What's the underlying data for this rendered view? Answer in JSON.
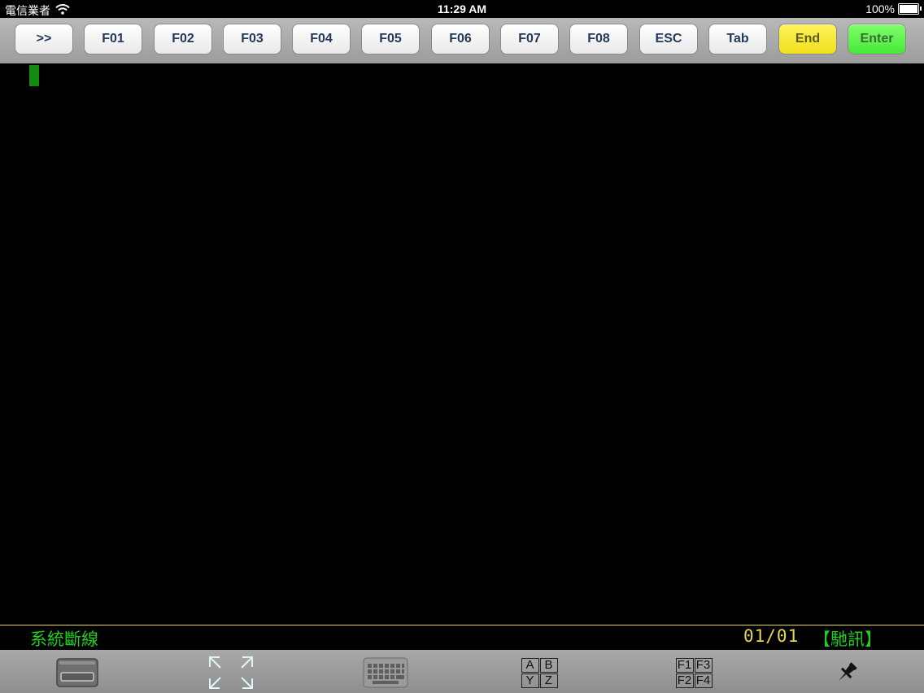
{
  "status_bar": {
    "carrier": "電信業者",
    "time": "11:29 AM",
    "battery_text": "100%",
    "battery_level": 1.0
  },
  "function_keys": [
    {
      "label": ">>",
      "color": "#ffffff"
    },
    {
      "label": "F01",
      "color": "#ffffff"
    },
    {
      "label": "F02",
      "color": "#ffffff"
    },
    {
      "label": "F03",
      "color": "#ffffff"
    },
    {
      "label": "F04",
      "color": "#ffffff"
    },
    {
      "label": "F05",
      "color": "#ffffff"
    },
    {
      "label": "F06",
      "color": "#ffffff"
    },
    {
      "label": "F07",
      "color": "#ffffff"
    },
    {
      "label": "F08",
      "color": "#ffffff"
    },
    {
      "label": "ESC",
      "color": "#ffffff"
    },
    {
      "label": "Tab",
      "color": "#ffffff"
    },
    {
      "label": "End",
      "color": "#f5e62a"
    },
    {
      "label": "Enter",
      "color": "#55f044"
    }
  ],
  "info_bar": {
    "connection_status": "系統斷線",
    "page_indicator": "01/01",
    "driver_label": "【馳訊】",
    "status_color": "#1fd01f",
    "page_color": "#e6d94a"
  },
  "bottom_toolbar": {
    "tools": [
      {
        "icon": "screen-window-icon"
      },
      {
        "icon": "expand-arrows-icon"
      },
      {
        "icon": "keyboard-icon"
      },
      {
        "icon": "abyz-letters-icon",
        "cells": [
          "A",
          "B",
          "Y",
          "Z"
        ]
      },
      {
        "icon": "function-keys-icon",
        "cells": [
          "F1",
          "F3",
          "F2",
          "F4"
        ]
      },
      {
        "icon": "pin-icon"
      }
    ]
  }
}
